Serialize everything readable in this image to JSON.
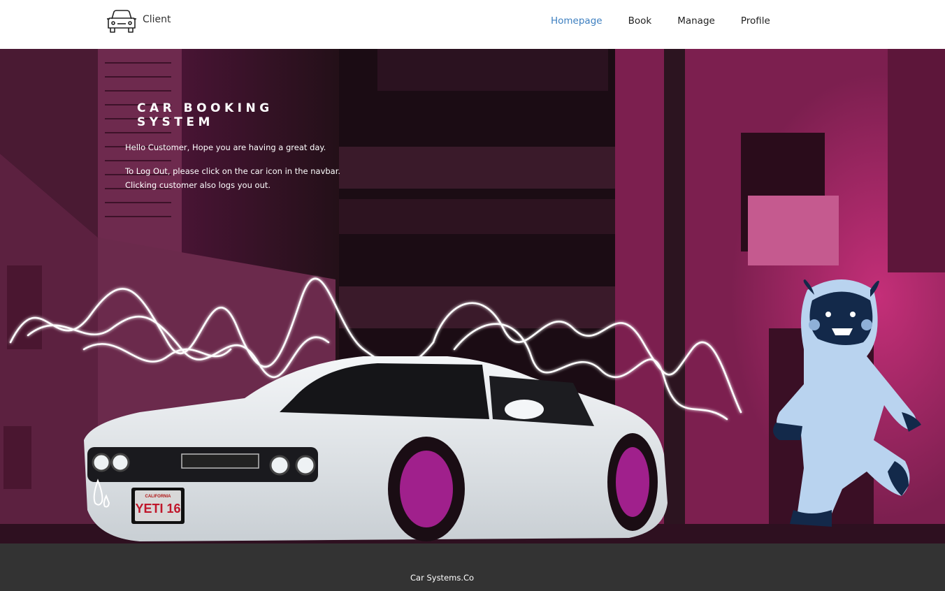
{
  "navbar": {
    "brand_icon": "car-icon",
    "brand_label": "Client",
    "links": [
      {
        "label": "Homepage",
        "active": true
      },
      {
        "label": "Book",
        "active": false
      },
      {
        "label": "Manage",
        "active": false
      },
      {
        "label": "Profile",
        "active": false
      }
    ],
    "active_color": "#3d7fc0"
  },
  "hero": {
    "title": "CAR BOOKING SYSTEM",
    "greeting": "Hello Customer, Hope you are having a great day.",
    "logout_line1": "To Log Out, please click on the car icon in the navbar.",
    "logout_line2": "Clicking customer also logs you out.",
    "plate_text": "YETI 16",
    "plate_state": "CALIFORNIA",
    "accent_color": "#e0287a"
  },
  "footer": {
    "text": "Car Systems.Co",
    "background": "#333333"
  }
}
